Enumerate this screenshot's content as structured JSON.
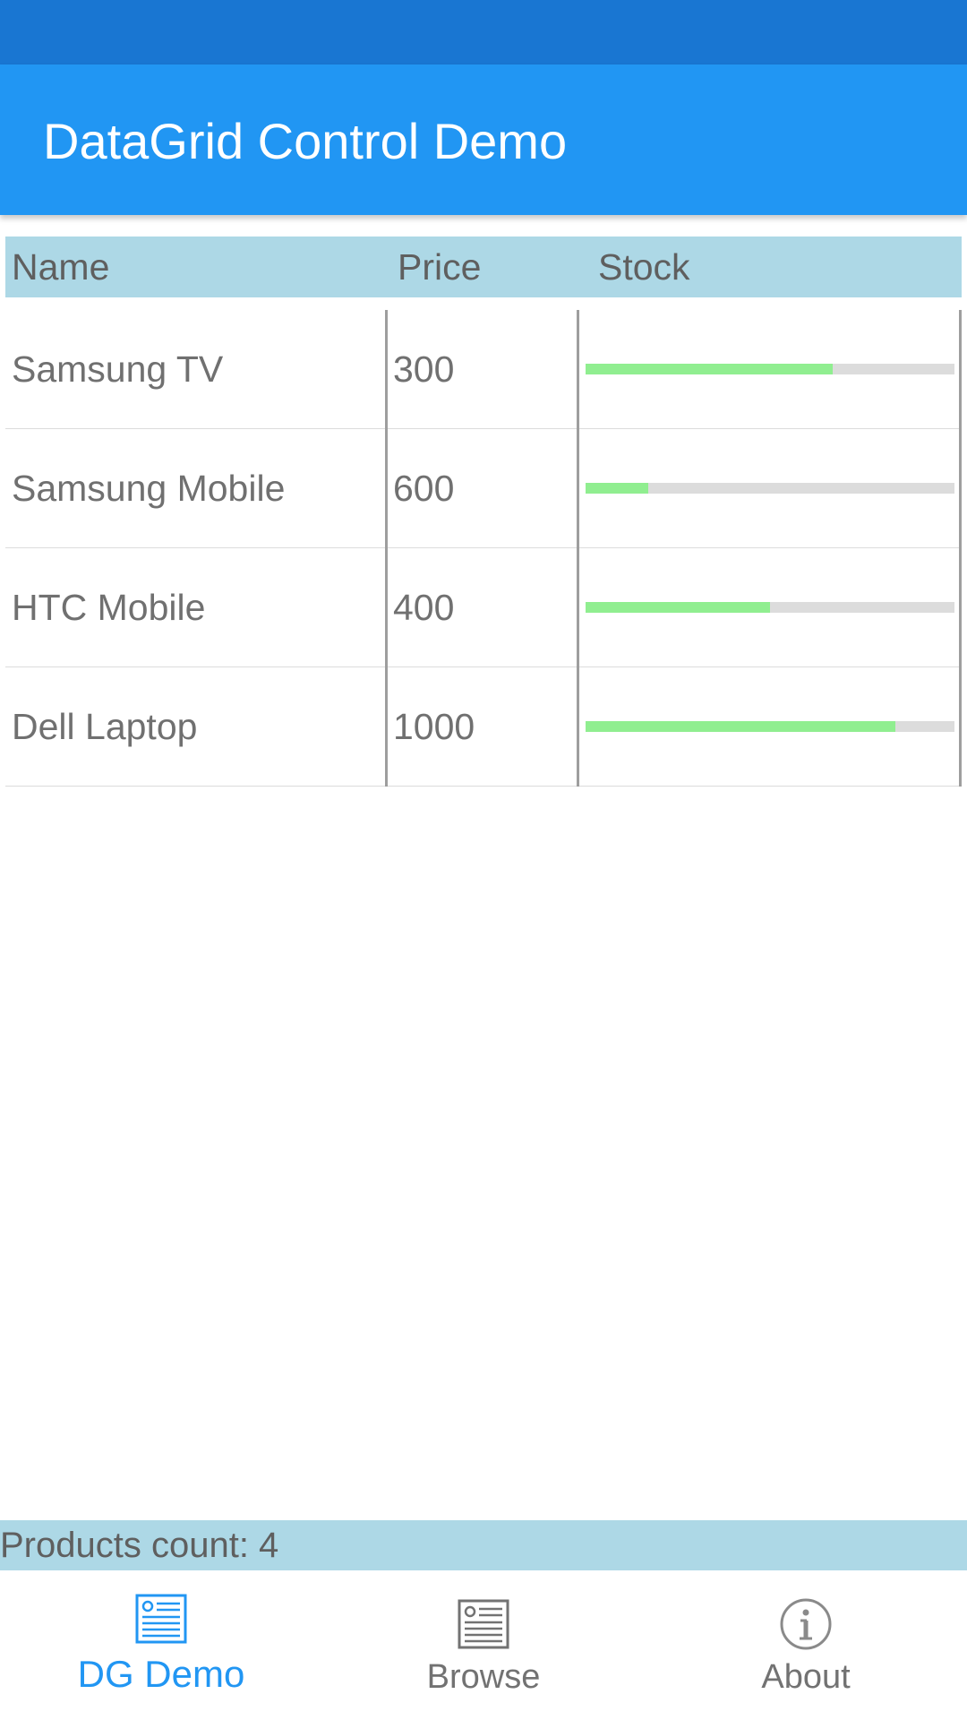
{
  "app": {
    "title": "DataGrid Control Demo"
  },
  "grid": {
    "columns": [
      "Name",
      "Price",
      "Stock"
    ],
    "rows": [
      {
        "name": "Samsung TV",
        "price": "300",
        "stock": 0.67
      },
      {
        "name": "Samsung Mobile",
        "price": "600",
        "stock": 0.17
      },
      {
        "name": "HTC Mobile",
        "price": "400",
        "stock": 0.5
      },
      {
        "name": "Dell Laptop",
        "price": "1000",
        "stock": 0.84
      }
    ]
  },
  "footer": {
    "count_text": "Products count: 4"
  },
  "tabs": [
    {
      "label": "DG Demo",
      "icon": "document-icon",
      "active": true
    },
    {
      "label": "Browse",
      "icon": "document-icon",
      "active": false
    },
    {
      "label": "About",
      "icon": "info-icon",
      "active": false
    }
  ],
  "colors": {
    "status_bar": "#1976d2",
    "app_bar": "#2196f3",
    "header_bg": "#add8e6",
    "stock_fill": "#90ee90",
    "stock_track": "#dcdcdc",
    "active_tab": "#2196f3"
  }
}
